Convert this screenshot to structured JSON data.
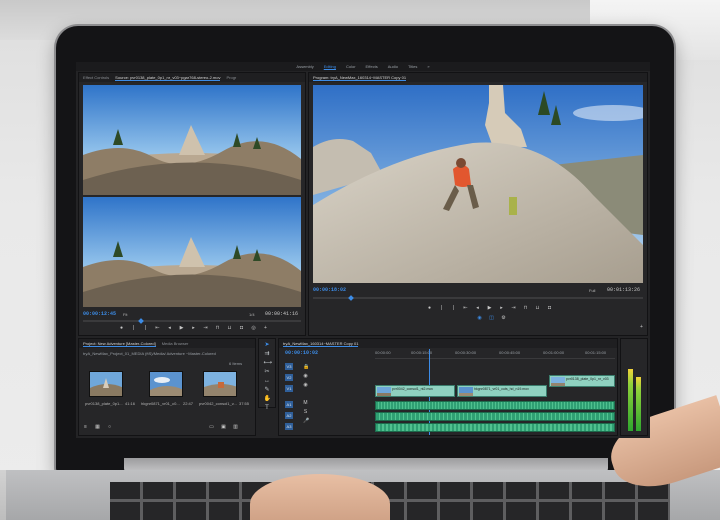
{
  "app": {
    "workspaces": [
      "Assembly",
      "Editing",
      "Color",
      "Effects",
      "Audio",
      "Titles",
      "»"
    ],
    "active_workspace": "Editing"
  },
  "source_monitor": {
    "tabs": [
      "Effect Controls",
      "Source: pvr0138_plate_0p1_nr_v03~pgar768-stereo-2.mov",
      "Progr"
    ],
    "timecode": "00:00:12:45",
    "zoom": "Fit",
    "fraction": "1/4",
    "duration": "00:00:41:16"
  },
  "program_monitor": {
    "tab": "Program: tryA_NewMax_160314~MASTER Copy 01",
    "timecode": "00:00:18:02",
    "zoom": "Full",
    "duration": "00:01:13:26"
  },
  "project": {
    "tabs": [
      "Project: New Adventure [Master-Colored]",
      "Media Browser"
    ],
    "path": "tryA_NewMax_Project_01_MEDIA (ftS)/Media/ Adventure ~Master-Colored",
    "items_label": "6 Items",
    "clips": [
      {
        "name": "pvr0138_plate_0p1...",
        "dur": "41:16"
      },
      {
        "name": "hkgnr0871_vr01_c0...",
        "dur": "22:47"
      },
      {
        "name": "pvr0042_consol1_v...",
        "dur": "37:55"
      }
    ]
  },
  "timeline": {
    "tab": "tryA_NewMax_160314~MASTER Copy 01",
    "timecode": "00:00:10:02",
    "ruler": [
      "00:00:00",
      "00:00:15:00",
      "00:00:30:00",
      "00:00:45:00",
      "00:01:00:00",
      "00:01:15:00"
    ],
    "video_tracks": [
      "V3",
      "V2",
      "V1"
    ],
    "audio_tracks": [
      "A1",
      "A2",
      "A3"
    ],
    "clips": [
      {
        "label": "pvr0042_consol1_nt2.mov"
      },
      {
        "label": "hkgnr0871_vr01_cuts_hd_n19.mov"
      },
      {
        "label": "pvr0138_plate_0p1_nr_v03"
      }
    ]
  },
  "colors": {
    "accent": "#3c8ce7",
    "video_clip": "#8fd1c0",
    "audio_clip": "#2f9f73"
  }
}
